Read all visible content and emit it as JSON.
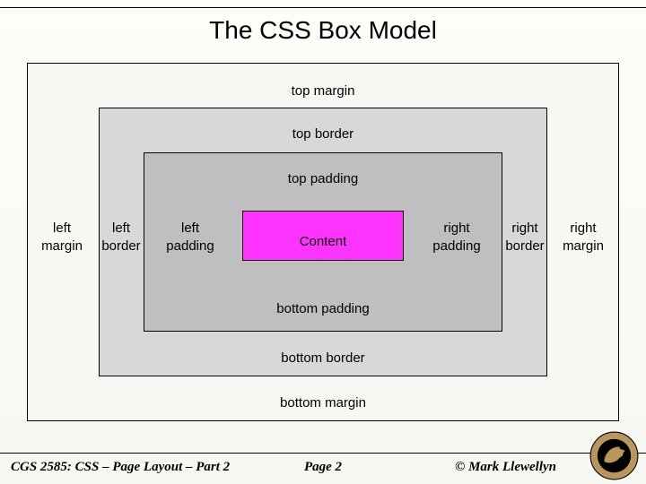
{
  "title": "The CSS Box Model",
  "labels": {
    "top_margin": "top margin",
    "top_border": "top border",
    "top_padding": "top padding",
    "left_margin": "left\nmargin",
    "left_border": "left\nborder",
    "left_padding": "left\npadding",
    "content": "Content",
    "right_padding": "right\npadding",
    "right_border": "right\nborder",
    "right_margin": "right\nmargin",
    "bottom_padding": "bottom padding",
    "bottom_border": "bottom border",
    "bottom_margin": "bottom margin"
  },
  "colors": {
    "margin_fill": "#f7f7f4",
    "border_fill": "#d8d8d8",
    "padding_fill": "#bfbfbf",
    "content_fill": "#ff33ff"
  },
  "footer": {
    "left": "CGS 2585: CSS – Page Layout – Part 2",
    "center": "Page 2",
    "right": "© Mark Llewellyn"
  },
  "logo_name": "ucf-pegasus-seal"
}
